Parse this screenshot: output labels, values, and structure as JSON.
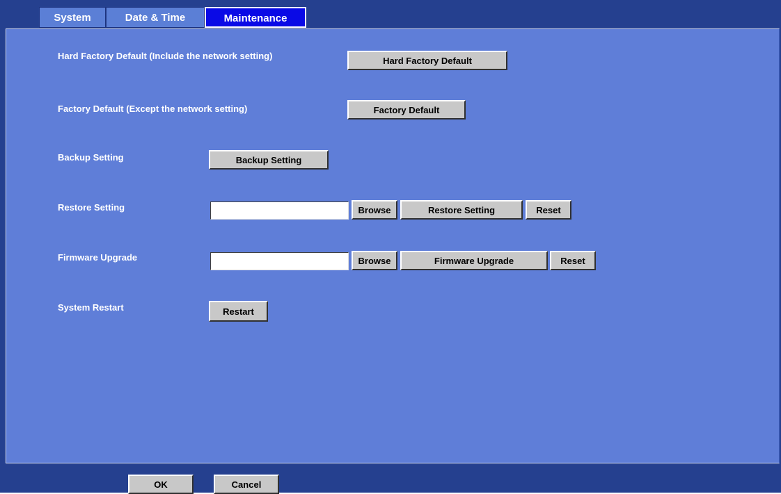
{
  "tabs": [
    {
      "label": "System",
      "active": false
    },
    {
      "label": "Date & Time",
      "active": false
    },
    {
      "label": "Maintenance",
      "active": true
    }
  ],
  "maintenance": {
    "hard_factory_default": {
      "label": "Hard Factory Default (Include the network setting)",
      "button": "Hard Factory Default"
    },
    "factory_default": {
      "label": "Factory Default (Except the network setting)",
      "button": "Factory Default"
    },
    "backup": {
      "label": "Backup Setting",
      "button": "Backup Setting"
    },
    "restore": {
      "label": "Restore Setting",
      "file_value": "",
      "browse": "Browse",
      "button": "Restore Setting",
      "reset": "Reset"
    },
    "firmware": {
      "label": "Firmware Upgrade",
      "file_value": "",
      "browse": "Browse",
      "button": "Firmware Upgrade",
      "reset": "Reset"
    },
    "restart": {
      "label": "System Restart",
      "button": "Restart"
    }
  },
  "footer": {
    "ok": "OK",
    "cancel": "Cancel"
  },
  "colors": {
    "frame": "#25408f",
    "panel": "#5f7ed8",
    "tab_inactive": "#5b7fd6",
    "tab_active": "#0a0ae6",
    "button_face": "#c8c8c8"
  }
}
